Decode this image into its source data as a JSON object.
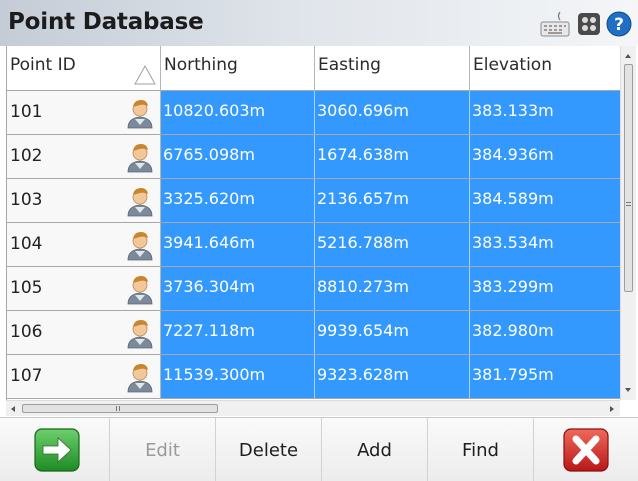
{
  "window": {
    "title": "Point Database"
  },
  "title_icons": [
    "keyboard-icon",
    "settings-icon",
    "help-icon"
  ],
  "table": {
    "columns": [
      "Point ID",
      "Northing",
      "Easting",
      "Elevation"
    ],
    "sort_indicator": "ascending",
    "rows": [
      {
        "id": "101",
        "northing": "10820.603m",
        "easting": "3060.696m",
        "elevation": "383.133m"
      },
      {
        "id": "102",
        "northing": "6765.098m",
        "easting": "1674.638m",
        "elevation": "384.936m"
      },
      {
        "id": "103",
        "northing": "3325.620m",
        "easting": "2136.657m",
        "elevation": "384.589m"
      },
      {
        "id": "104",
        "northing": "3941.646m",
        "easting": "5216.788m",
        "elevation": "383.534m"
      },
      {
        "id": "105",
        "northing": "3736.304m",
        "easting": "8810.273m",
        "elevation": "383.299m"
      },
      {
        "id": "106",
        "northing": "7227.118m",
        "easting": "9939.654m",
        "elevation": "382.980m"
      },
      {
        "id": "107",
        "northing": "11539.300m",
        "easting": "9323.628m",
        "elevation": "381.795m"
      }
    ],
    "row_icon": "person-icon"
  },
  "toolbar": {
    "ok_icon": "arrow-right-icon",
    "edit_label": "Edit",
    "delete_label": "Delete",
    "add_label": "Add",
    "find_label": "Find",
    "close_icon": "close-x-icon"
  },
  "colors": {
    "selection": "#3399ff",
    "selection_text": "#ffffff",
    "ok_button": "#3aa83a",
    "close_button": "#d42a2a"
  }
}
